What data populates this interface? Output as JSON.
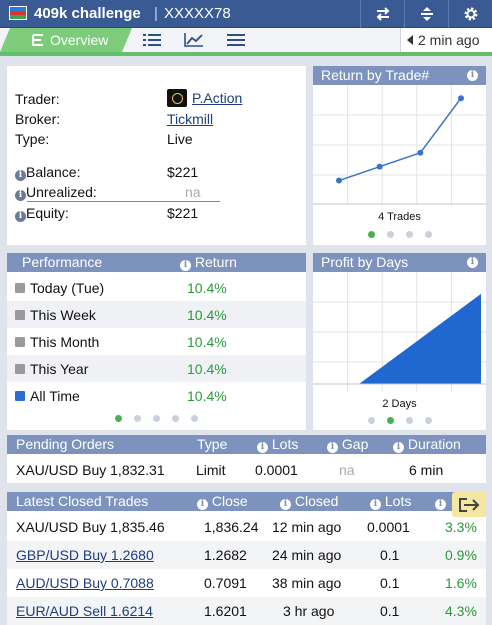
{
  "header": {
    "title": "409k challenge",
    "separator": "|",
    "account": "XXXXX78"
  },
  "tabs": {
    "overview_label": "Overview",
    "updated": "2 min ago"
  },
  "trader_info": {
    "rows": [
      {
        "label": "Trader:",
        "value": "P.Action"
      },
      {
        "label": "Broker:",
        "value": "Tickmill"
      },
      {
        "label": "Type:",
        "value": "Live"
      }
    ],
    "balance": {
      "label": "Balance:",
      "value": "$221"
    },
    "unrealized": {
      "label": "Unrealized:",
      "value": "na"
    },
    "equity": {
      "label": "Equity:",
      "value": "$221"
    }
  },
  "return_by_trade": {
    "title": "Return by Trade#",
    "caption": "4 Trades"
  },
  "performance": {
    "header_label": "Performance",
    "header_return": "Return",
    "rows": [
      {
        "label": "Today (Tue)",
        "value": "10.4%"
      },
      {
        "label": "This Week",
        "value": "10.4%"
      },
      {
        "label": "This Month",
        "value": "10.4%"
      },
      {
        "label": "This Year",
        "value": "10.4%"
      },
      {
        "label": "All Time",
        "value": "10.4%"
      }
    ]
  },
  "profit_by_days": {
    "title": "Profit by Days",
    "caption": "2 Days"
  },
  "pending_orders": {
    "headers": {
      "name": "Pending Orders",
      "type": "Type",
      "lots": "Lots",
      "gap": "Gap",
      "duration": "Duration"
    },
    "row": {
      "name": "XAU/USD Buy 1,832.31",
      "type": "Limit",
      "lots": "0.0001",
      "gap": "na",
      "duration": "6 min"
    }
  },
  "closed_trades": {
    "headers": {
      "name": "Latest Closed Trades",
      "close": "Close",
      "closed": "Closed",
      "lots": "Lots"
    },
    "rows": [
      {
        "name": "XAU/USD Buy 1,835.46",
        "close": "1,836.24",
        "closed": "12 min ago",
        "lots": "0.0001",
        "pct": "3.3%"
      },
      {
        "name": "GBP/USD Buy 1.2680",
        "close": "1.2682",
        "closed": "24 min ago",
        "lots": "0.1",
        "pct": "0.9%"
      },
      {
        "name": "AUD/USD Buy 0.7088",
        "close": "0.7091",
        "closed": "38 min ago",
        "lots": "0.1",
        "pct": "1.6%"
      },
      {
        "name": "EUR/AUD Sell 1.6214",
        "close": "1.6201",
        "closed": "3 hr ago",
        "lots": "0.1",
        "pct": "4.3%"
      }
    ]
  },
  "chart_data": [
    {
      "type": "line",
      "title": "Return by Trade#",
      "x": [
        1,
        2,
        3,
        4
      ],
      "values": [
        0.9,
        2.5,
        4.1,
        10.4
      ],
      "ylim": [
        -1,
        11
      ]
    },
    {
      "type": "area",
      "title": "Profit by Days",
      "x": [
        1,
        2
      ],
      "values": [
        0,
        10.4
      ],
      "ylim": [
        0,
        12
      ]
    }
  ],
  "colors": {
    "topbar": "#3a5a94",
    "panel_header": "#7d93bd",
    "accent_green": "#63c06a",
    "positive": "#2a9a3a",
    "chart_line": "#3d72c8",
    "chart_fill": "#2068d0"
  }
}
